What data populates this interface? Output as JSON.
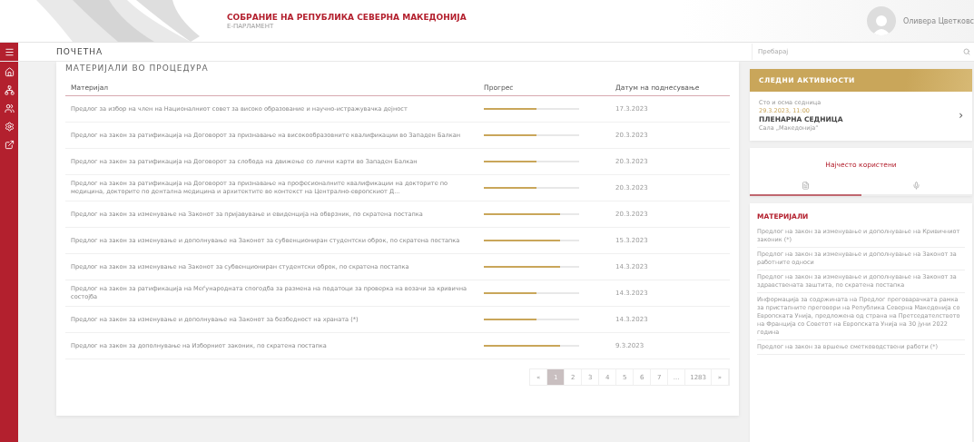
{
  "header": {
    "title": "СОБРАНИЕ НА РЕПУБЛИКА СЕВЕРНА МАКЕДОНИЈА",
    "subtitle": "Е-ПАРЛАМЕНТ",
    "user": "Оливера Цветковс"
  },
  "nav": {
    "title": "ПОЧЕТНА",
    "search": {
      "placeholder": "Пребарај"
    }
  },
  "sidebar": {
    "items": [
      {
        "kind": "home"
      },
      {
        "kind": "organization"
      },
      {
        "kind": "people"
      },
      {
        "kind": "settings"
      },
      {
        "kind": "external"
      }
    ]
  },
  "materials_table": {
    "title": "МАТЕРИЈАЛИ ВО ПРОЦЕДУРА",
    "columns": [
      "Материјал",
      "Прогрес",
      "Датум на поднесување"
    ],
    "rows": [
      {
        "material": "Предлог за избор на член на Националниот совет за високо образование и научно-истражувачка дејност",
        "level": 0.55,
        "date": "17.3.2023"
      },
      {
        "material": "Предлог на закон за ратификација на Договорот за признавање на високообразовните квалификации во Западен Балкан",
        "level": 0.55,
        "date": "20.3.2023"
      },
      {
        "material": "Предлог на закон за ратификација на Договорот за слобода на движење со лични карти во Западен Балкан",
        "level": 0.55,
        "date": "20.3.2023"
      },
      {
        "material": "Предлог на закон за ратификација на Договорот за признавање на професионалните квалификации на докторите по медицина, докторите по дентална медицина и архитектите во контекст на Централно-европскиот Д...",
        "level": 0.55,
        "date": "20.3.2023"
      },
      {
        "material": "Предлог на закон за изменување на Законот за пријавување и евиденција на обврзник, по скратена постапка",
        "level": 0.8,
        "date": "20.3.2023"
      },
      {
        "material": "Предлог на закон за изменување и дополнување на Законот за субвенциониран студентски оброк, по скратена постапка",
        "level": 0.8,
        "date": "15.3.2023"
      },
      {
        "material": "Предлог на закон за изменување на Законот за субвенциониран студентски оброк, по скратена постапка",
        "level": 0.8,
        "date": "14.3.2023"
      },
      {
        "material": "Предлог на закон за ратификација на Меѓународната спогодба за размена на податоци за проверка на возачи за кривична состојба",
        "level": 0.55,
        "date": "14.3.2023"
      },
      {
        "material": "Предлог на закон за изменување и дополнување на Законот за безбедност на храната (*)",
        "level": 0.55,
        "date": "14.3.2023"
      },
      {
        "material": "Предлог на закон за дополнување на Изборниот законик, по скратена постапка",
        "level": 0.8,
        "date": "9.3.2023"
      }
    ],
    "pagination": [
      {
        "label": "«",
        "selected": false
      },
      {
        "label": "1",
        "selected": true
      },
      {
        "label": "2",
        "selected": false
      },
      {
        "label": "3",
        "selected": false
      },
      {
        "label": "4",
        "selected": false
      },
      {
        "label": "5",
        "selected": false
      },
      {
        "label": "6",
        "selected": false
      },
      {
        "label": "7",
        "selected": false
      },
      {
        "label": "...",
        "selected": false
      },
      {
        "label": "1283",
        "selected": false
      },
      {
        "label": "»",
        "selected": false
      }
    ]
  },
  "next_activities": {
    "title": "СЛЕДНИ АКТИВНОСТИ",
    "session": "Сто и осма седница",
    "datetime": "29.3.2023, 11:00",
    "type": "ПЛЕНАРНА СЕДНИЦА",
    "room": "Сала „Македонија“",
    "arrow": "›"
  },
  "most_used": {
    "title": "Најчесто користени",
    "tabs": [
      {
        "kind": "document",
        "selected": true
      },
      {
        "kind": "microphone",
        "selected": false
      }
    ],
    "section": "МАТЕРИЈАЛИ",
    "items": [
      "Предлог на закон за изменување и дополнување на Кривичниот законик (*)",
      "Предлог на закон за изменување и дополнување на Законот за работните односи",
      "Предлог на закон за изменување и дополнување на Законот за здравствената заштита, по скратена постапка",
      "Информација за содржината на Предлог преговарачката рамка за пристапните преговори на Република Северна Македонија со Европската Унија, предложена од страна на Претседателството на Франција со Советот на Европската Унија на 30 јуни 2022 година",
      "Предлог на закон за вршење сметководствени работи (*)"
    ]
  }
}
